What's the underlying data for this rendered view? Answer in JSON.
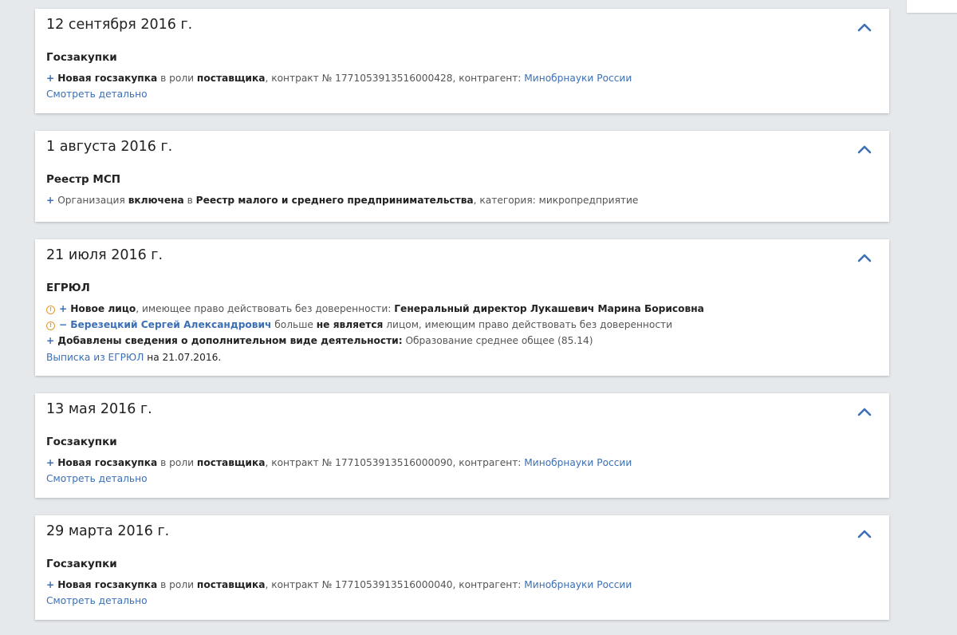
{
  "events": [
    {
      "date": "12 сентября 2016 г.",
      "section": "Госзакупки",
      "line": {
        "bold1": "Новая госзакупка",
        "t1": " в роли ",
        "bold2": "поставщика",
        "t2": ", контракт № 1771053913516000428, контрагент: ",
        "link": "Минобрнауки России"
      },
      "detail": "Смотреть детально"
    },
    {
      "date": "1 августа 2016 г.",
      "section": "Реестр МСП",
      "line": {
        "t0": "Организация ",
        "bold1": "включена",
        "t1": " в ",
        "bold2": "Реестр малого и среднего предпринимательства",
        "t2": ", категория: микропредприятие"
      }
    },
    {
      "date": "21 июля 2016 г.",
      "section": "ЕГРЮЛ",
      "line1": {
        "bold1": "Новое лицо",
        "t1": ", имеющее право действовать без доверенности: ",
        "bold2": "Генеральный директор Лукашевич Марина Борисовна"
      },
      "line2": {
        "link": "Березецкий Сергей Александрович",
        "t1": " больше ",
        "bold1": "не является",
        "t2": " лицом, имеющим право действовать без доверенности"
      },
      "line3": {
        "bold1": "Добавлены сведения о дополнительном виде деятельности:",
        "t1": " Образование среднее общее (85.14)"
      },
      "extract_link": "Выписка из ЕГРЮЛ",
      "extract_date": " на 21.07.2016."
    },
    {
      "date": "13 мая 2016 г.",
      "section": "Госзакупки",
      "line": {
        "bold1": "Новая госзакупка",
        "t1": " в роли ",
        "bold2": "поставщика",
        "t2": ", контракт № 1771053913516000090, контрагент: ",
        "link": "Минобрнауки России"
      },
      "detail": "Смотреть детально"
    },
    {
      "date": "29 марта 2016 г.",
      "section": "Госзакупки",
      "line": {
        "bold1": "Новая госзакупка",
        "t1": " в роли ",
        "bold2": "поставщика",
        "t2": ", контракт № 1771053913516000040, контрагент: ",
        "link": "Минобрнауки России"
      },
      "detail": "Смотреть детально"
    }
  ],
  "symbols": {
    "plus": "+",
    "minus": "−",
    "warn": "!"
  },
  "colors": {
    "accent": "#3b6fb6",
    "warning": "#e39a2c",
    "background": "#e6e9ec"
  }
}
